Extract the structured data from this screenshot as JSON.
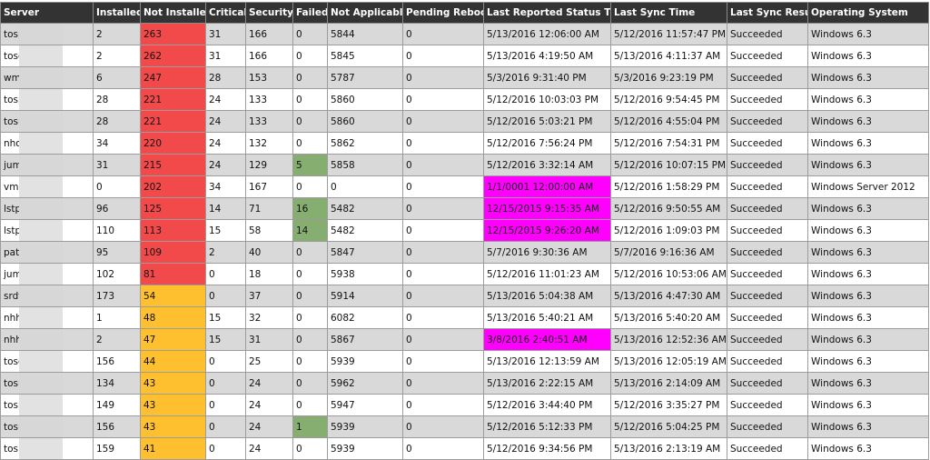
{
  "columns": [
    "Server",
    "Installed",
    "Not Installed",
    "Critical",
    "Security",
    "Failed",
    "Not Applicable",
    "Pending Reboot",
    "Last Reported Status Time",
    "Last Sync Time",
    "Last Sync Result",
    "Operating System"
  ],
  "rows": [
    {
      "server": "tosp",
      "installed": "2",
      "not_installed": "263",
      "ni_status": "red",
      "critical": "31",
      "security": "166",
      "failed": "0",
      "failed_status": "",
      "not_applicable": "5844",
      "pending_reboot": "0",
      "last_reported": "5/13/2016 12:06:00 AM",
      "reported_status": "",
      "last_sync": "5/12/2016 11:57:47 PM",
      "sync_result": "Succeeded",
      "os": "Windows 6.3"
    },
    {
      "server": "tosg",
      "installed": "2",
      "not_installed": "262",
      "ni_status": "red",
      "critical": "31",
      "security": "166",
      "failed": "0",
      "failed_status": "",
      "not_applicable": "5845",
      "pending_reboot": "0",
      "last_reported": "5/13/2016 4:19:50 AM",
      "reported_status": "",
      "last_sync": "5/13/2016 4:11:37 AM",
      "sync_result": "Succeeded",
      "os": "Windows 6.3"
    },
    {
      "server": "wm",
      "installed": "6",
      "not_installed": "247",
      "ni_status": "red",
      "critical": "28",
      "security": "153",
      "failed": "0",
      "failed_status": "",
      "not_applicable": "5787",
      "pending_reboot": "0",
      "last_reported": "5/3/2016 9:31:40 PM",
      "reported_status": "",
      "last_sync": "5/3/2016 9:23:19 PM",
      "sync_result": "Succeeded",
      "os": "Windows 6.3"
    },
    {
      "server": "tosp",
      "installed": "28",
      "not_installed": "221",
      "ni_status": "red",
      "critical": "24",
      "security": "133",
      "failed": "0",
      "failed_status": "",
      "not_applicable": "5860",
      "pending_reboot": "0",
      "last_reported": "5/12/2016 10:03:03 PM",
      "reported_status": "",
      "last_sync": "5/12/2016 9:54:45 PM",
      "sync_result": "Succeeded",
      "os": "Windows 6.3"
    },
    {
      "server": "tosn",
      "installed": "28",
      "not_installed": "221",
      "ni_status": "red",
      "critical": "24",
      "security": "133",
      "failed": "0",
      "failed_status": "",
      "not_applicable": "5860",
      "pending_reboot": "0",
      "last_reported": "5/12/2016 5:03:21 PM",
      "reported_status": "",
      "last_sync": "5/12/2016 4:55:04 PM",
      "sync_result": "Succeeded",
      "os": "Windows 6.3"
    },
    {
      "server": "nho",
      "installed": "34",
      "not_installed": "220",
      "ni_status": "red",
      "critical": "24",
      "security": "132",
      "failed": "0",
      "failed_status": "",
      "not_applicable": "5862",
      "pending_reboot": "0",
      "last_reported": "5/12/2016 7:56:24 PM",
      "reported_status": "",
      "last_sync": "5/12/2016 7:54:31 PM",
      "sync_result": "Succeeded",
      "os": "Windows 6.3"
    },
    {
      "server": "jum",
      "installed": "31",
      "not_installed": "215",
      "ni_status": "red",
      "critical": "24",
      "security": "129",
      "failed": "5",
      "failed_status": "green",
      "not_applicable": "5858",
      "pending_reboot": "0",
      "last_reported": "5/12/2016 3:32:14 AM",
      "reported_status": "",
      "last_sync": "5/12/2016 10:07:15 PM",
      "sync_result": "Succeeded",
      "os": "Windows 6.3"
    },
    {
      "server": "vmb",
      "installed": "0",
      "not_installed": "202",
      "ni_status": "red",
      "critical": "34",
      "security": "167",
      "failed": "0",
      "failed_status": "",
      "not_applicable": "0",
      "pending_reboot": "0",
      "last_reported": "1/1/0001 12:00:00 AM",
      "reported_status": "magenta",
      "last_sync": "5/12/2016 1:58:29 PM",
      "sync_result": "Succeeded",
      "os": "Windows Server 2012"
    },
    {
      "server": "lstpa",
      "installed": "96",
      "not_installed": "125",
      "ni_status": "red",
      "critical": "14",
      "security": "71",
      "failed": "16",
      "failed_status": "green",
      "not_applicable": "5482",
      "pending_reboot": "0",
      "last_reported": "12/15/2015 9:15:35 AM",
      "reported_status": "magenta",
      "last_sync": "5/12/2016 9:50:55 AM",
      "sync_result": "Succeeded",
      "os": "Windows 6.3"
    },
    {
      "server": "lstpa",
      "installed": "110",
      "not_installed": "113",
      "ni_status": "red",
      "critical": "15",
      "security": "58",
      "failed": "14",
      "failed_status": "green",
      "not_applicable": "5482",
      "pending_reboot": "0",
      "last_reported": "12/15/2015 9:26:20 AM",
      "reported_status": "magenta",
      "last_sync": "5/12/2016 1:09:03 PM",
      "sync_result": "Succeeded",
      "os": "Windows 6.3"
    },
    {
      "server": "patc",
      "installed": "95",
      "not_installed": "109",
      "ni_status": "red",
      "critical": "2",
      "security": "40",
      "failed": "0",
      "failed_status": "",
      "not_applicable": "5847",
      "pending_reboot": "0",
      "last_reported": "5/7/2016 9:30:36 AM",
      "reported_status": "",
      "last_sync": "5/7/2016 9:16:36 AM",
      "sync_result": "Succeeded",
      "os": "Windows 6.3"
    },
    {
      "server": "jum",
      "installed": "102",
      "not_installed": "81",
      "ni_status": "red",
      "critical": "0",
      "security": "18",
      "failed": "0",
      "failed_status": "",
      "not_applicable": "5938",
      "pending_reboot": "0",
      "last_reported": "5/12/2016 11:01:23 AM",
      "reported_status": "",
      "last_sync": "5/12/2016 10:53:06 AM",
      "sync_result": "Succeeded",
      "os": "Windows 6.3"
    },
    {
      "server": "srdt",
      "installed": "173",
      "not_installed": "54",
      "ni_status": "amber",
      "critical": "0",
      "security": "37",
      "failed": "0",
      "failed_status": "",
      "not_applicable": "5914",
      "pending_reboot": "0",
      "last_reported": "5/13/2016 5:04:38 AM",
      "reported_status": "",
      "last_sync": "5/13/2016 4:47:30 AM",
      "sync_result": "Succeeded",
      "os": "Windows 6.3"
    },
    {
      "server": "nhh",
      "installed": "1",
      "not_installed": "48",
      "ni_status": "amber",
      "critical": "15",
      "security": "32",
      "failed": "0",
      "failed_status": "",
      "not_applicable": "6082",
      "pending_reboot": "0",
      "last_reported": "5/13/2016 5:40:21 AM",
      "reported_status": "",
      "last_sync": "5/13/2016 5:40:20 AM",
      "sync_result": "Succeeded",
      "os": "Windows 6.3"
    },
    {
      "server": "nhh",
      "installed": "2",
      "not_installed": "47",
      "ni_status": "amber",
      "critical": "15",
      "security": "31",
      "failed": "0",
      "failed_status": "",
      "not_applicable": "5867",
      "pending_reboot": "0",
      "last_reported": "3/8/2016 2:40:51 AM",
      "reported_status": "magenta",
      "last_sync": "5/13/2016 12:52:36 AM",
      "sync_result": "Succeeded",
      "os": "Windows 6.3"
    },
    {
      "server": "tosg",
      "installed": "156",
      "not_installed": "44",
      "ni_status": "amber",
      "critical": "0",
      "security": "25",
      "failed": "0",
      "failed_status": "",
      "not_applicable": "5939",
      "pending_reboot": "0",
      "last_reported": "5/13/2016 12:13:59 AM",
      "reported_status": "",
      "last_sync": "5/13/2016 12:05:19 AM",
      "sync_result": "Succeeded",
      "os": "Windows 6.3"
    },
    {
      "server": "tosr",
      "installed": "134",
      "not_installed": "43",
      "ni_status": "amber",
      "critical": "0",
      "security": "24",
      "failed": "0",
      "failed_status": "",
      "not_applicable": "5962",
      "pending_reboot": "0",
      "last_reported": "5/13/2016 2:22:15 AM",
      "reported_status": "",
      "last_sync": "5/13/2016 2:14:09 AM",
      "sync_result": "Succeeded",
      "os": "Windows 6.3"
    },
    {
      "server": "tosn",
      "installed": "149",
      "not_installed": "43",
      "ni_status": "amber",
      "critical": "0",
      "security": "24",
      "failed": "0",
      "failed_status": "",
      "not_applicable": "5947",
      "pending_reboot": "0",
      "last_reported": "5/12/2016 3:44:40 PM",
      "reported_status": "",
      "last_sync": "5/12/2016 3:35:27 PM",
      "sync_result": "Succeeded",
      "os": "Windows 6.3"
    },
    {
      "server": "tosr",
      "installed": "156",
      "not_installed": "43",
      "ni_status": "amber",
      "critical": "0",
      "security": "24",
      "failed": "1",
      "failed_status": "green",
      "not_applicable": "5939",
      "pending_reboot": "0",
      "last_reported": "5/12/2016 5:12:33 PM",
      "reported_status": "",
      "last_sync": "5/12/2016 5:04:25 PM",
      "sync_result": "Succeeded",
      "os": "Windows 6.3"
    },
    {
      "server": "tos",
      "installed": "159",
      "not_installed": "41",
      "ni_status": "amber",
      "critical": "0",
      "security": "24",
      "failed": "0",
      "failed_status": "",
      "not_applicable": "5939",
      "pending_reboot": "0",
      "last_reported": "5/12/2016 9:34:56 PM",
      "reported_status": "",
      "last_sync": "5/13/2016 2:13:19 AM",
      "sync_result": "Succeeded",
      "os": "Windows 6.3"
    }
  ]
}
